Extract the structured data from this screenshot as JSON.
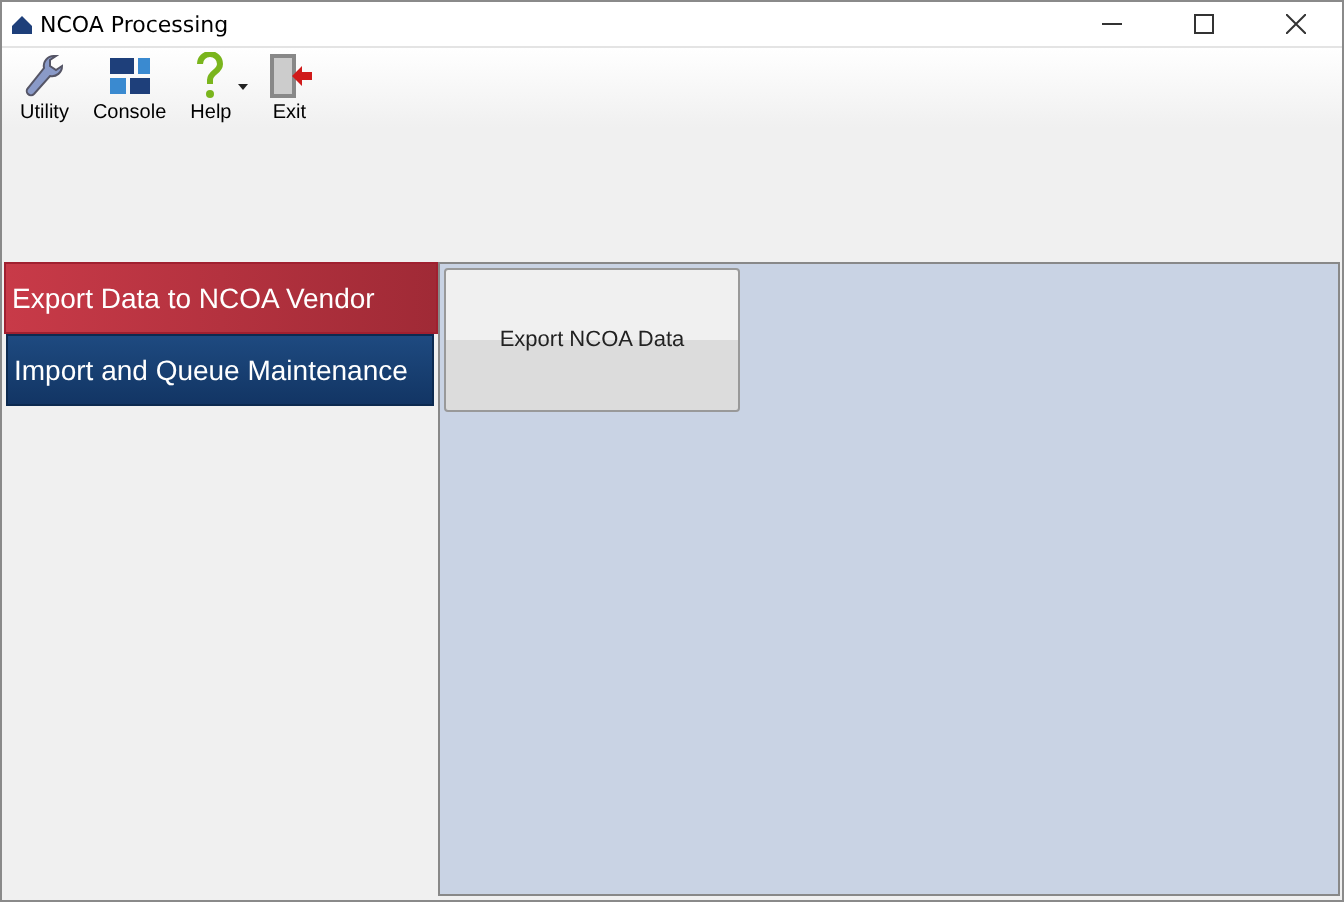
{
  "window": {
    "title": "NCOA Processing"
  },
  "toolbar": [
    {
      "kind": "utility",
      "label": "Utility"
    },
    {
      "kind": "console",
      "label": "Console"
    },
    {
      "kind": "help",
      "label": "Help",
      "dropdown": true
    },
    {
      "kind": "exit",
      "label": "Exit"
    }
  ],
  "nav": [
    {
      "label": "Export Data to NCOA Vendor",
      "selected": true
    },
    {
      "label": "Import and Queue Maintenance",
      "selected": false
    }
  ],
  "buttons": [
    "Export NCOA Data"
  ]
}
